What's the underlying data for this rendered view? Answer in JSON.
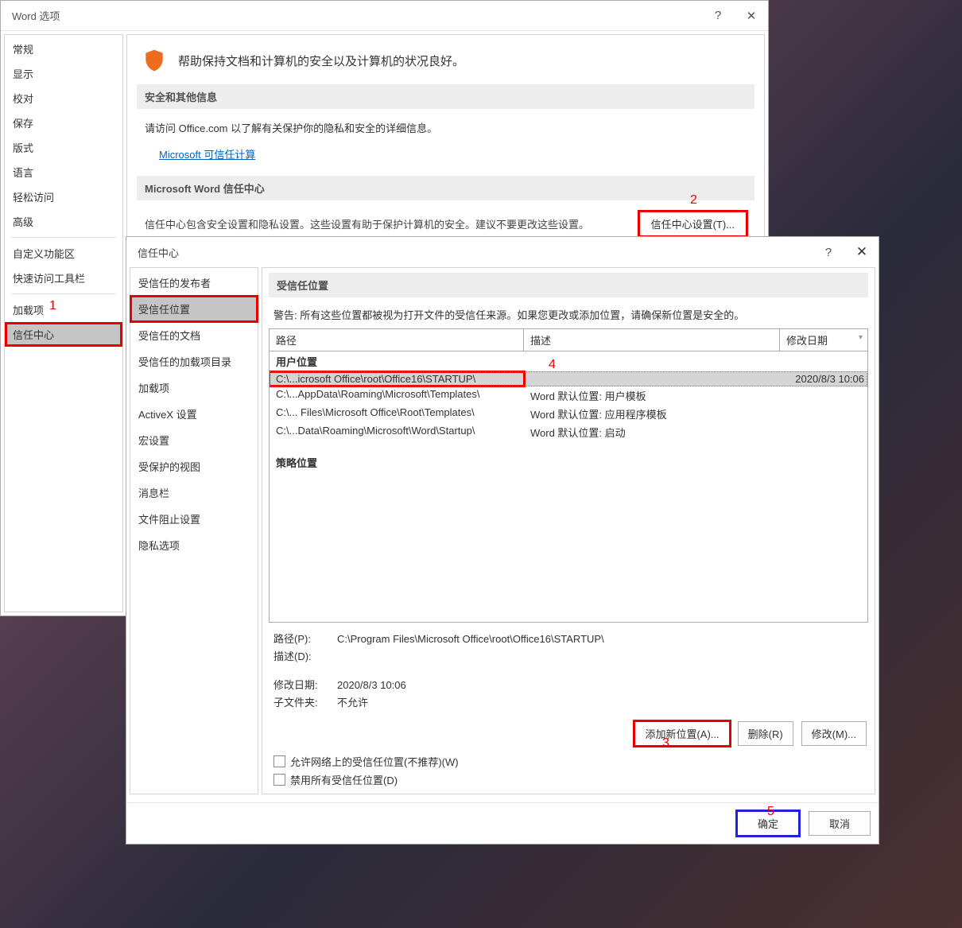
{
  "word_options": {
    "title": "Word 选项",
    "sidebar": {
      "items": [
        "常规",
        "显示",
        "校对",
        "保存",
        "版式",
        "语言",
        "轻松访问",
        "高级"
      ],
      "items2": [
        "自定义功能区",
        "快速访问工具栏"
      ],
      "items3": [
        "加载项",
        "信任中心"
      ]
    },
    "main": {
      "headline": "帮助保持文档和计算机的安全以及计算机的状况良好。",
      "sec1_title": "安全和其他信息",
      "sec1_text_prefix": "请访问 Office.com  以了解有关保护你的隐私和安全的详细信息。",
      "sec1_link": "Microsoft 可信任计算",
      "sec2_title": "Microsoft Word 信任中心",
      "sec2_text": "信任中心包含安全设置和隐私设置。这些设置有助于保护计算机的安全。建议不要更改这些设置。",
      "sec2_button": "信任中心设置(T)..."
    }
  },
  "trust_center": {
    "title": "信任中心",
    "sidebar": [
      "受信任的发布者",
      "受信任位置",
      "受信任的文档",
      "受信任的加载项目录",
      "加载项",
      "ActiveX 设置",
      "宏设置",
      "受保护的视图",
      "消息栏",
      "文件阻止设置",
      "隐私选项"
    ],
    "content": {
      "header": "受信任位置",
      "warning": "警告: 所有这些位置都被视为打开文件的受信任来源。如果您更改或添加位置，请确保新位置是安全的。",
      "columns": {
        "path": "路径",
        "desc": "描述",
        "date": "修改日期"
      },
      "group1": "用户位置",
      "rows": [
        {
          "path": "C:\\...icrosoft Office\\root\\Office16\\STARTUP\\",
          "desc": "",
          "date": "2020/8/3 10:06",
          "selected": true
        },
        {
          "path": "C:\\...AppData\\Roaming\\Microsoft\\Templates\\",
          "desc": "Word 默认位置: 用户模板",
          "date": ""
        },
        {
          "path": "C:\\... Files\\Microsoft Office\\Root\\Templates\\",
          "desc": "Word 默认位置: 应用程序模板",
          "date": ""
        },
        {
          "path": "C:\\...Data\\Roaming\\Microsoft\\Word\\Startup\\",
          "desc": "Word 默认位置: 启动",
          "date": ""
        }
      ],
      "group2": "策略位置",
      "details": {
        "path_label": "路径(P):",
        "path_value": "C:\\Program Files\\Microsoft Office\\root\\Office16\\STARTUP\\",
        "desc_label": "描述(D):",
        "date_label": "修改日期:",
        "date_value": "2020/8/3 10:06",
        "sub_label": "子文件夹:",
        "sub_value": "不允许"
      },
      "actions": {
        "add": "添加新位置(A)...",
        "remove": "删除(R)",
        "modify": "修改(M)..."
      },
      "checkbox1": "允许网络上的受信任位置(不推荐)(W)",
      "checkbox2": "禁用所有受信任位置(D)",
      "footer": {
        "ok": "确定",
        "cancel": "取消"
      }
    }
  },
  "annotations": {
    "a1": "1",
    "a2": "2",
    "a3": "3",
    "a4": "4",
    "a5": "5"
  }
}
